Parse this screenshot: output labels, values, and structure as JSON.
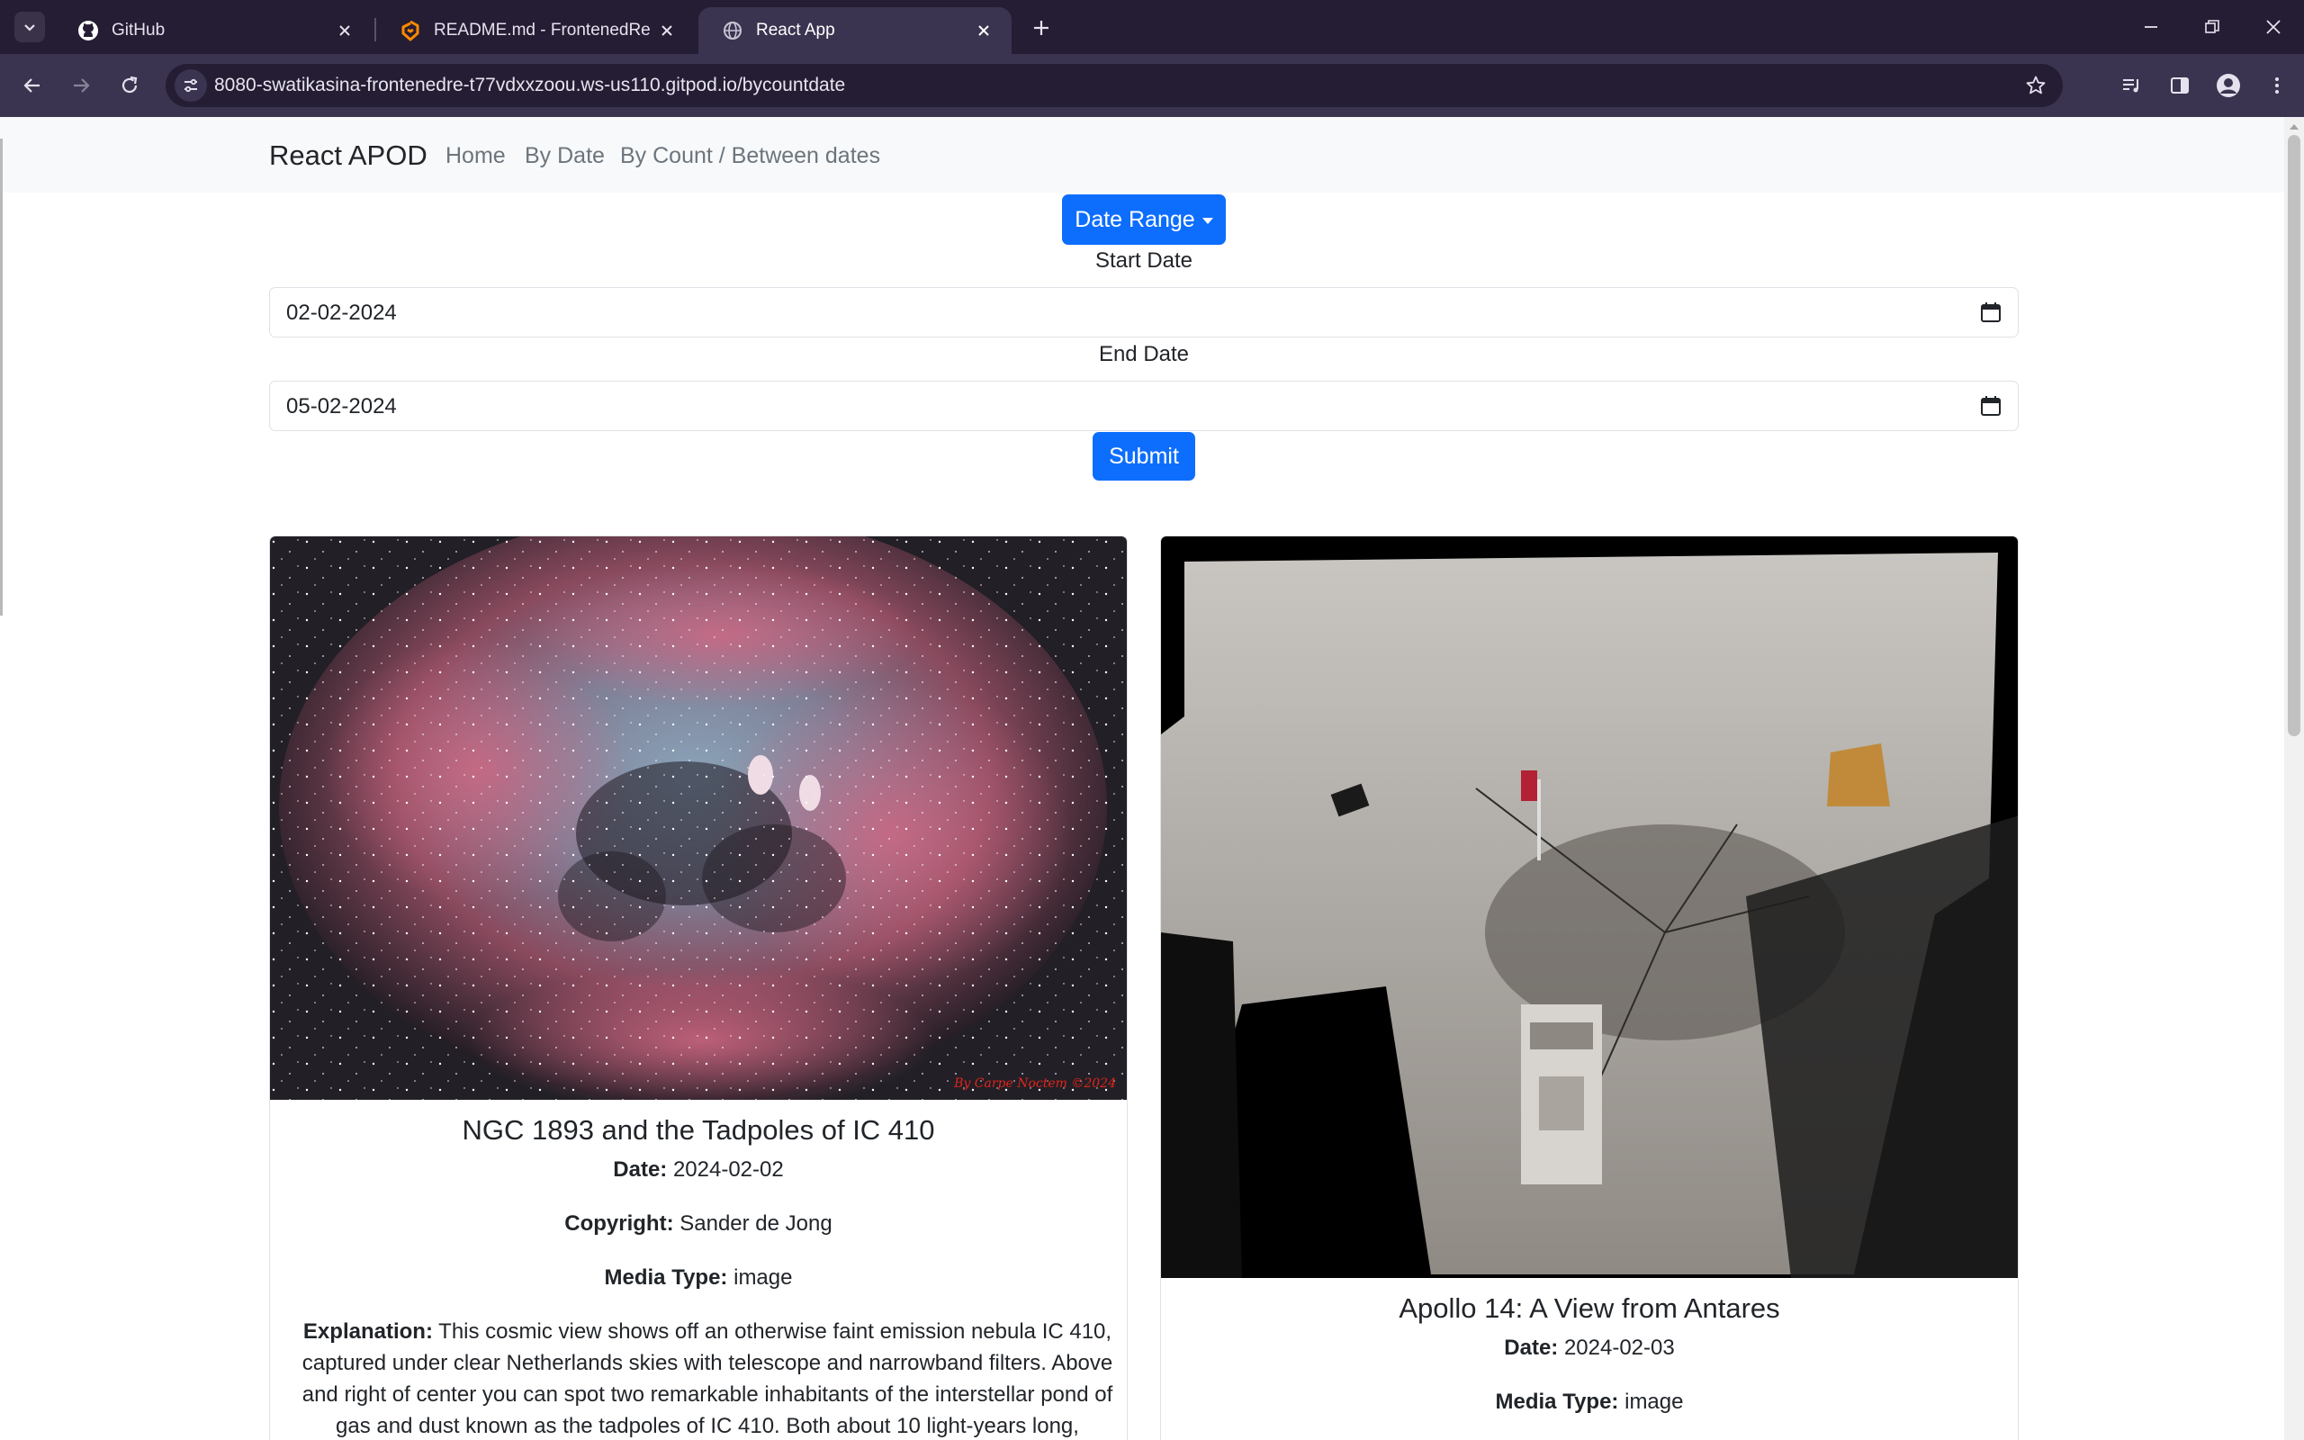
{
  "browser": {
    "tabs": [
      {
        "title": "GitHub",
        "icon": "github-icon"
      },
      {
        "title": "README.md - FrontenedReactA",
        "icon": "gitpod-icon"
      },
      {
        "title": "React App",
        "icon": "globe-icon"
      }
    ],
    "url": "8080-swatikasina-frontenedre-t77vdxxzoou.ws-us110.gitpod.io/bycountdate"
  },
  "navbar": {
    "brand": "React APOD",
    "links": [
      "Home",
      "By Date",
      "By Count / Between dates"
    ]
  },
  "form": {
    "dropdown_label": "Date Range",
    "start_label": "Start Date",
    "start_value": "02-02-2024",
    "end_label": "End Date",
    "end_value": "05-02-2024",
    "submit_label": "Submit"
  },
  "cards": [
    {
      "title": "NGC 1893 and the Tadpoles of IC 410",
      "date_label": "Date:",
      "date": "2024-02-02",
      "copyright_label": "Copyright:",
      "copyright": "Sander de Jong",
      "media_label": "Media Type:",
      "media_type": "image",
      "explanation_label": "Explanation:",
      "explanation": "This cosmic view shows off an otherwise faint emission nebula IC 410, captured under clear Netherlands skies with telescope and narrowband filters. Above and right of center you can spot two remarkable inhabitants of the interstellar pond of gas and dust known as the tadpoles of IC 410. Both about 10 light-years long,",
      "image_watermark": "By Carpe Noctem ©2024"
    },
    {
      "title": "Apollo 14: A View from Antares",
      "date_label": "Date:",
      "date": "2024-02-03",
      "media_label": "Media Type:",
      "media_type": "image"
    }
  ]
}
